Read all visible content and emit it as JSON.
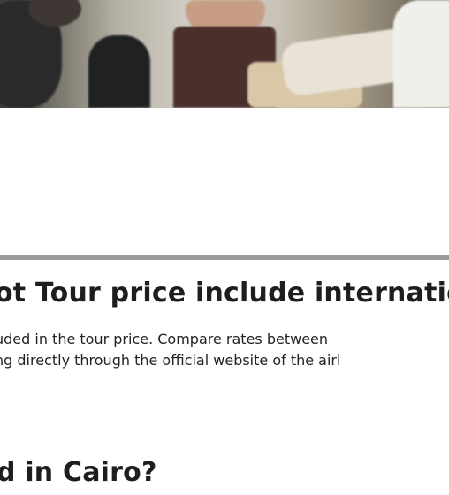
{
  "faq": {
    "question_1": "ot Tour price include internatio",
    "answer_line_1_before_link": "uded in the tour price. Compare rates betw",
    "answer_line_1_link": "een",
    "answer_line_2": "ng directly through the official website of the airl",
    "question_2": "d in Cairo?"
  },
  "colors": {
    "divider": "#9a9a9a",
    "heading": "#1e1e1e",
    "link_underline": "#3a7bd5"
  }
}
